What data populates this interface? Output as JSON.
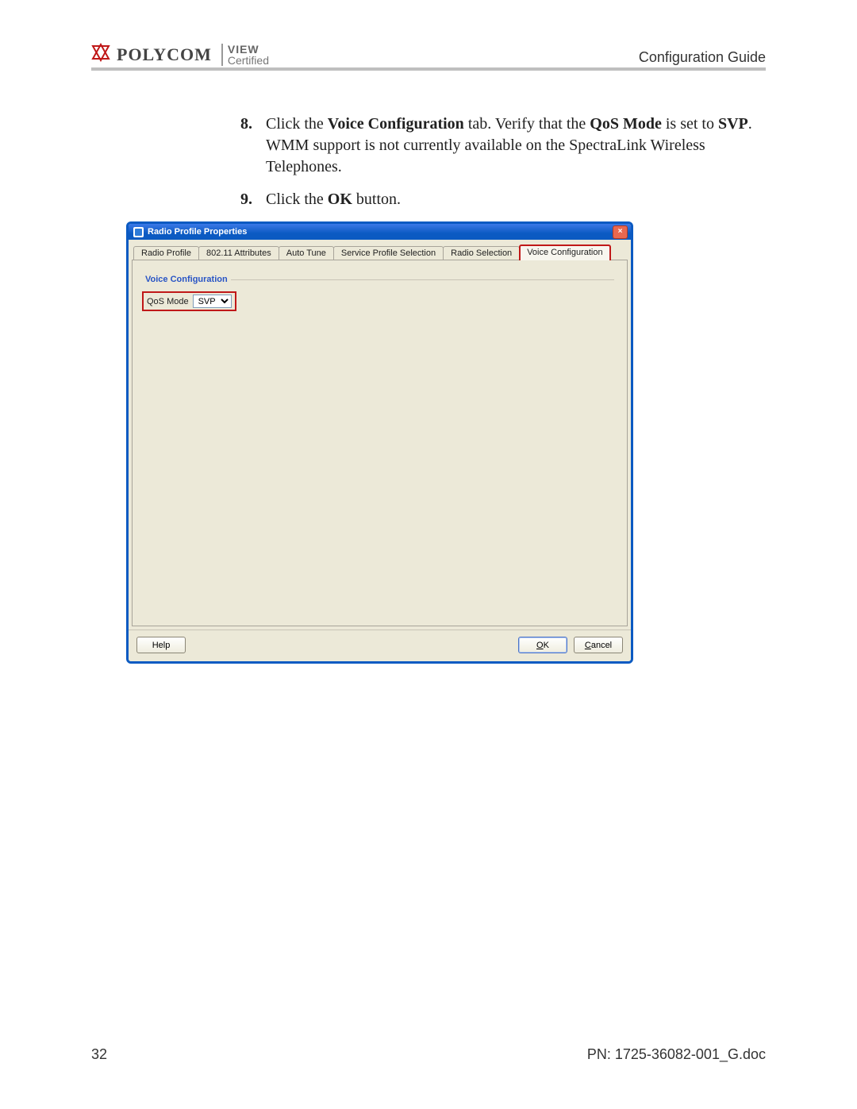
{
  "header": {
    "brand_name": "POLYCOM",
    "view": "VIEW",
    "cert": "Certified",
    "doc_title": "Configuration Guide"
  },
  "steps": [
    {
      "num": "8.",
      "html": "Click the <b>Voice Configuration</b> tab. Verify that the <b>QoS Mode</b> is set to <b>SVP</b>. WMM support is not currently available on the SpectraLink Wireless Telephones."
    },
    {
      "num": "9.",
      "html": "Click the <b>OK</b> button."
    }
  ],
  "dialog": {
    "title": "Radio Profile Properties",
    "close": "×",
    "tabs": [
      "Radio Profile",
      "802.11 Attributes",
      "Auto Tune",
      "Service Profile Selection",
      "Radio Selection",
      "Voice Configuration"
    ],
    "active_tab_index": 5,
    "fieldset": "Voice Configuration",
    "qos_label": "QoS Mode",
    "qos_value": "SVP",
    "buttons": {
      "help": "Help",
      "ok": "OK",
      "cancel": "Cancel"
    }
  },
  "footer": {
    "page": "32",
    "pn": "PN: 1725-36082-001_G.doc"
  }
}
